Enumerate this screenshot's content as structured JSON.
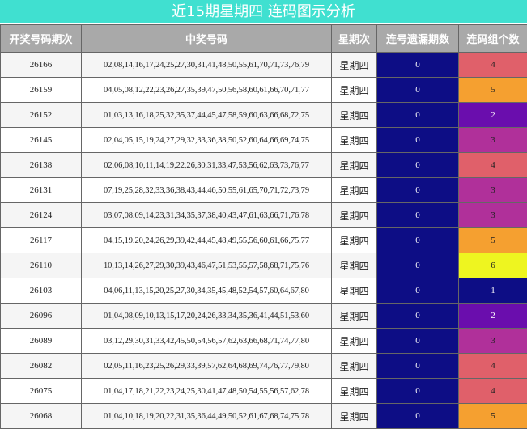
{
  "title": "近15期星期四 连码图示分析",
  "headers": [
    "开奖号码期次",
    "中奖号码",
    "星期次",
    "连号遗漏期数",
    "连码组个数"
  ],
  "colors": {
    "title_bg": "#40e0d0",
    "header_bg": "#a9a9a9",
    "miss_bg": "#0d0d85",
    "count_1": "#0d0d85",
    "count_2": "#6a0dad",
    "count_3": "#b0309a",
    "count_4": "#e0606a",
    "count_5": "#f5a030",
    "count_6": "#eef520"
  },
  "rows": [
    {
      "period": "26166",
      "numbers": "02,08,14,16,17,24,25,27,30,31,41,48,50,55,61,70,71,73,76,79",
      "weekday": "星期四",
      "miss": "0",
      "count": "4"
    },
    {
      "period": "26159",
      "numbers": "04,05,08,12,22,23,26,27,35,39,47,50,56,58,60,61,66,70,71,77",
      "weekday": "星期四",
      "miss": "0",
      "count": "5"
    },
    {
      "period": "26152",
      "numbers": "01,03,13,16,18,25,32,35,37,44,45,47,58,59,60,63,66,68,72,75",
      "weekday": "星期四",
      "miss": "0",
      "count": "2"
    },
    {
      "period": "26145",
      "numbers": "02,04,05,15,19,24,27,29,32,33,36,38,50,52,60,64,66,69,74,75",
      "weekday": "星期四",
      "miss": "0",
      "count": "3"
    },
    {
      "period": "26138",
      "numbers": "02,06,08,10,11,14,19,22,26,30,31,33,47,53,56,62,63,73,76,77",
      "weekday": "星期四",
      "miss": "0",
      "count": "4"
    },
    {
      "period": "26131",
      "numbers": "07,19,25,28,32,33,36,38,43,44,46,50,55,61,65,70,71,72,73,79",
      "weekday": "星期四",
      "miss": "0",
      "count": "3"
    },
    {
      "period": "26124",
      "numbers": "03,07,08,09,14,23,31,34,35,37,38,40,43,47,61,63,66,71,76,78",
      "weekday": "星期四",
      "miss": "0",
      "count": "3"
    },
    {
      "period": "26117",
      "numbers": "04,15,19,20,24,26,29,39,42,44,45,48,49,55,56,60,61,66,75,77",
      "weekday": "星期四",
      "miss": "0",
      "count": "5"
    },
    {
      "period": "26110",
      "numbers": "10,13,14,26,27,29,30,39,43,46,47,51,53,55,57,58,68,71,75,76",
      "weekday": "星期四",
      "miss": "0",
      "count": "6"
    },
    {
      "period": "26103",
      "numbers": "04,06,11,13,15,20,25,27,30,34,35,45,48,52,54,57,60,64,67,80",
      "weekday": "星期四",
      "miss": "0",
      "count": "1"
    },
    {
      "period": "26096",
      "numbers": "01,04,08,09,10,13,15,17,20,24,26,33,34,35,36,41,44,51,53,60",
      "weekday": "星期四",
      "miss": "0",
      "count": "2"
    },
    {
      "period": "26089",
      "numbers": "03,12,29,30,31,33,42,45,50,54,56,57,62,63,66,68,71,74,77,80",
      "weekday": "星期四",
      "miss": "0",
      "count": "3"
    },
    {
      "period": "26082",
      "numbers": "02,05,11,16,23,25,26,29,33,39,57,62,64,68,69,74,76,77,79,80",
      "weekday": "星期四",
      "miss": "0",
      "count": "4"
    },
    {
      "period": "26075",
      "numbers": "01,04,17,18,21,22,23,24,25,30,41,47,48,50,54,55,56,57,62,78",
      "weekday": "星期四",
      "miss": "0",
      "count": "4"
    },
    {
      "period": "26068",
      "numbers": "01,04,10,18,19,20,22,31,35,36,44,49,50,52,61,67,68,74,75,78",
      "weekday": "星期四",
      "miss": "0",
      "count": "5"
    }
  ]
}
